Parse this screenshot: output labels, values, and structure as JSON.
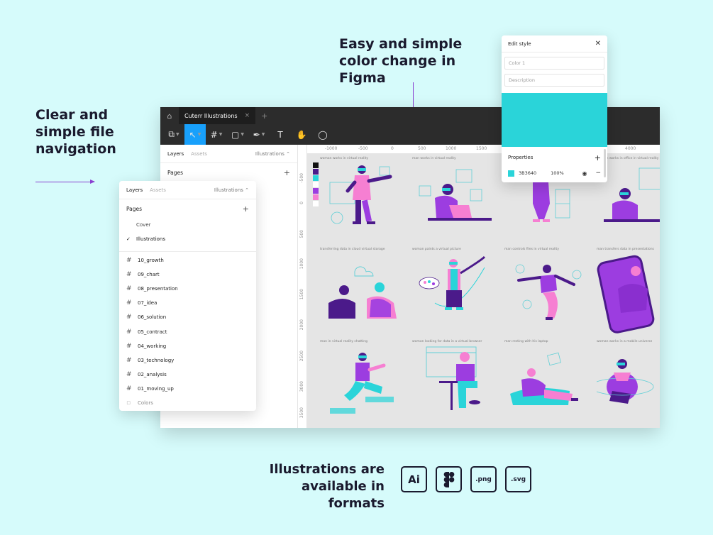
{
  "promo": {
    "left_text": "Clear and simple file navigation",
    "top_text": "Easy and simple color change in Figma",
    "bottom_text": "Illustrations are available in formats"
  },
  "titlebar": {
    "file_name": "Cuterr Illustrations",
    "home_icon": "home-icon",
    "close_tab_glyph": "×",
    "new_tab_glyph": "+"
  },
  "toolbar": {
    "tools": [
      {
        "name": "main-menu-icon",
        "glyph": "⧉"
      },
      {
        "name": "move-tool-icon",
        "glyph": "↖"
      },
      {
        "name": "frame-tool-icon",
        "glyph": "#"
      },
      {
        "name": "shape-tool-icon",
        "glyph": "▢"
      },
      {
        "name": "pen-tool-icon",
        "glyph": "✒"
      },
      {
        "name": "text-tool-icon",
        "glyph": "T"
      },
      {
        "name": "hand-tool-icon",
        "glyph": "✋"
      },
      {
        "name": "comment-tool-icon",
        "glyph": "◯"
      }
    ]
  },
  "left_panel": {
    "tab_layers": "Layers",
    "tab_assets": "Assets",
    "page_selector": "Illustrations ⌃",
    "pages_label": "Pages",
    "add_glyph": "+"
  },
  "ruler": {
    "h_ticks": [
      "-1000",
      "-500",
      "0",
      "500",
      "1000",
      "1500",
      "4000"
    ],
    "v_ticks": [
      "-500",
      "0",
      "500",
      "1000",
      "1500",
      "2000",
      "2500",
      "3000",
      "3500"
    ]
  },
  "canvas": {
    "swatch_colors": [
      "#111111",
      "#4b1a8a",
      "#2ad4d9",
      "#ffffff",
      "#9c3de0",
      "#f67fd2",
      "#ffffff"
    ],
    "captions": [
      "woman works in virtual reality",
      "man works in virtual reality",
      "man works in virtual reality",
      "woman works in office in virtual reality",
      "transferring data in cloud virtual storage",
      "woman paints a virtual picture",
      "man controls files in virtual reality",
      "man transfers data in presentations",
      "man in virtual reality chatting",
      "woman looking for data in a virtual browser",
      "man resting with his laptop",
      "woman works in a mobile universe"
    ]
  },
  "layers_panel": {
    "tab_layers": "Layers",
    "tab_assets": "Assets",
    "page_selector": "Illustrations ⌃",
    "pages_label": "Pages",
    "add_glyph": "+",
    "pages": [
      {
        "label": "Cover",
        "checked": false
      },
      {
        "label": "Illustrations",
        "checked": true
      }
    ],
    "check_glyph": "✓",
    "frames": [
      "10_growth",
      "09_chart",
      "08_presentation",
      "07_idea",
      "06_solution",
      "05_contract",
      "04_working",
      "03_technology",
      "02_analysis",
      "01_moving_up"
    ],
    "colors_label": "Colors",
    "hash_glyph": "#"
  },
  "edit_style": {
    "title": "Edit style",
    "close_glyph": "✕",
    "name_value": "Color 1",
    "description_placeholder": "Description",
    "color_hex": "#2ad4d9",
    "properties_label": "Properties",
    "add_glyph": "+",
    "fill_hex_label": "3B3640",
    "opacity": "100%",
    "eye_glyph": "👁",
    "minus_glyph": "−"
  },
  "formats": {
    "items": [
      {
        "name": "ai-format-badge",
        "label": "Ai"
      },
      {
        "name": "figma-format-badge",
        "label": ""
      },
      {
        "name": "png-format-badge",
        "label": ".png"
      },
      {
        "name": "svg-format-badge",
        "label": ".svg"
      }
    ]
  }
}
